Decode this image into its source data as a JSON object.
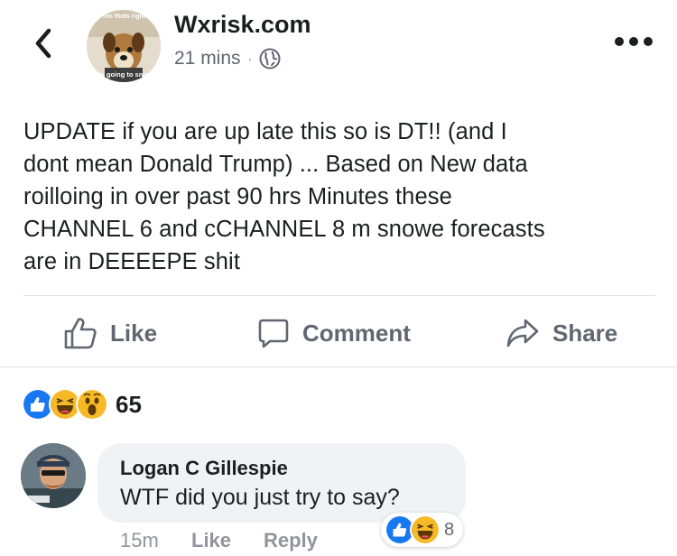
{
  "header": {
    "page_name": "Wxrisk.com",
    "time": "21 mins",
    "separator": "·",
    "avatar_caption_top": "Yes thats right",
    "avatar_caption_bottom": "It's going to snow"
  },
  "post": {
    "text": "UPDATE  if you are up late  this  so is  DT!!   (and I\ndont mean  Donald Trump) ... Based on New data\nroilloing in over past  90 hrs  Minutes  these\nCHANNEL 6  and cCHANNEL 8  m  snowe  forecasts\nare in DEEEEPE  shit"
  },
  "actions": {
    "like": "Like",
    "comment": "Comment",
    "share": "Share"
  },
  "reactions": {
    "types": [
      "like-icon",
      "haha-icon",
      "wow-icon"
    ],
    "count": "65"
  },
  "comment": {
    "author": "Logan C Gillespie",
    "text": "WTF did you just try to say?",
    "time": "15m",
    "like_label": "Like",
    "reply_label": "Reply",
    "reaction_types": [
      "like-icon",
      "haha-icon"
    ],
    "reaction_count": "8"
  },
  "colors": {
    "like_blue": "#1877f2",
    "haha_yellow": "#f7b928",
    "muted": "#606770"
  }
}
